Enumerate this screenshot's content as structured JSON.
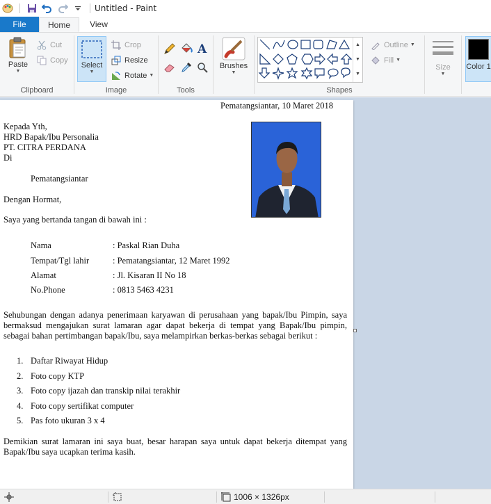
{
  "window": {
    "title": "Untitled - Paint"
  },
  "tabs": {
    "file": "File",
    "home": "Home",
    "view": "View"
  },
  "ribbon": {
    "clipboard": {
      "label": "Clipboard",
      "paste": "Paste",
      "cut": "Cut",
      "copy": "Copy"
    },
    "image": {
      "label": "Image",
      "select": "Select",
      "crop": "Crop",
      "resize": "Resize",
      "rotate": "Rotate"
    },
    "tools": {
      "label": "Tools"
    },
    "brushes": {
      "label": "Brushes"
    },
    "shapes": {
      "label": "Shapes",
      "outline": "Outline",
      "fill": "Fill"
    },
    "size": {
      "label": "Size"
    },
    "color1": {
      "label": "Color 1",
      "value": "#000000"
    }
  },
  "document": {
    "date_line": "Pematangsiantar, 10 Maret 2018",
    "to_1": "Kepada Yth,",
    "to_2": "HRD Bapak/Ibu Personalia",
    "to_3": "PT. CITRA PERDANA",
    "to_4": "Di",
    "to_city": "Pematangsiantar",
    "greeting": "Dengan Hormat,",
    "intro": "Saya yang bertanda tangan di bawah ini :",
    "fields": [
      {
        "label": "Nama",
        "value": ": Paskal Rian Duha"
      },
      {
        "label": "Tempat/Tgl lahir",
        "value": ": Pematangsiantar, 12 Maret 1992"
      },
      {
        "label": "Alamat",
        "value": ": Jl. Kisaran II No 18"
      },
      {
        "label": "No.Phone",
        "value": ": 0813 5463 4231"
      }
    ],
    "body_1": "Sehubungan dengan adanya penerimaan karyawan di perusahaan yang bapak/Ibu Pimpin, saya",
    "body_2": "bermaksud mengajukan surat lamaran agar dapat bekerja di tempat yang Bapak/Ibu pimpin,",
    "body_3": "sebagai bahan pertimbangan bapak/Ibu, saya melampirkan berkas-berkas sebagai berikut :",
    "attachments": [
      {
        "num": "1.",
        "text": "Daftar Riwayat Hidup"
      },
      {
        "num": "2.",
        "text": "Foto copy KTP"
      },
      {
        "num": "3.",
        "text": "Foto copy ijazah dan transkip nilai terakhir"
      },
      {
        "num": "4.",
        "text": "Foto copy sertifikat computer"
      },
      {
        "num": "5.",
        "text": "Pas foto ukuran 3 x 4"
      }
    ],
    "closing_1": "Demikian surat lamaran ini saya buat, besar harapan saya untuk dapat bekerja ditempat yang",
    "closing_2": "Bapak/Ibu saya ucapkan terima kasih."
  },
  "statusbar": {
    "image_size": "1006 × 1326px"
  },
  "colors": {
    "file_tab": "#1979ca",
    "workspace": "#c9d6e6",
    "photo_background": "#2a63d8"
  }
}
